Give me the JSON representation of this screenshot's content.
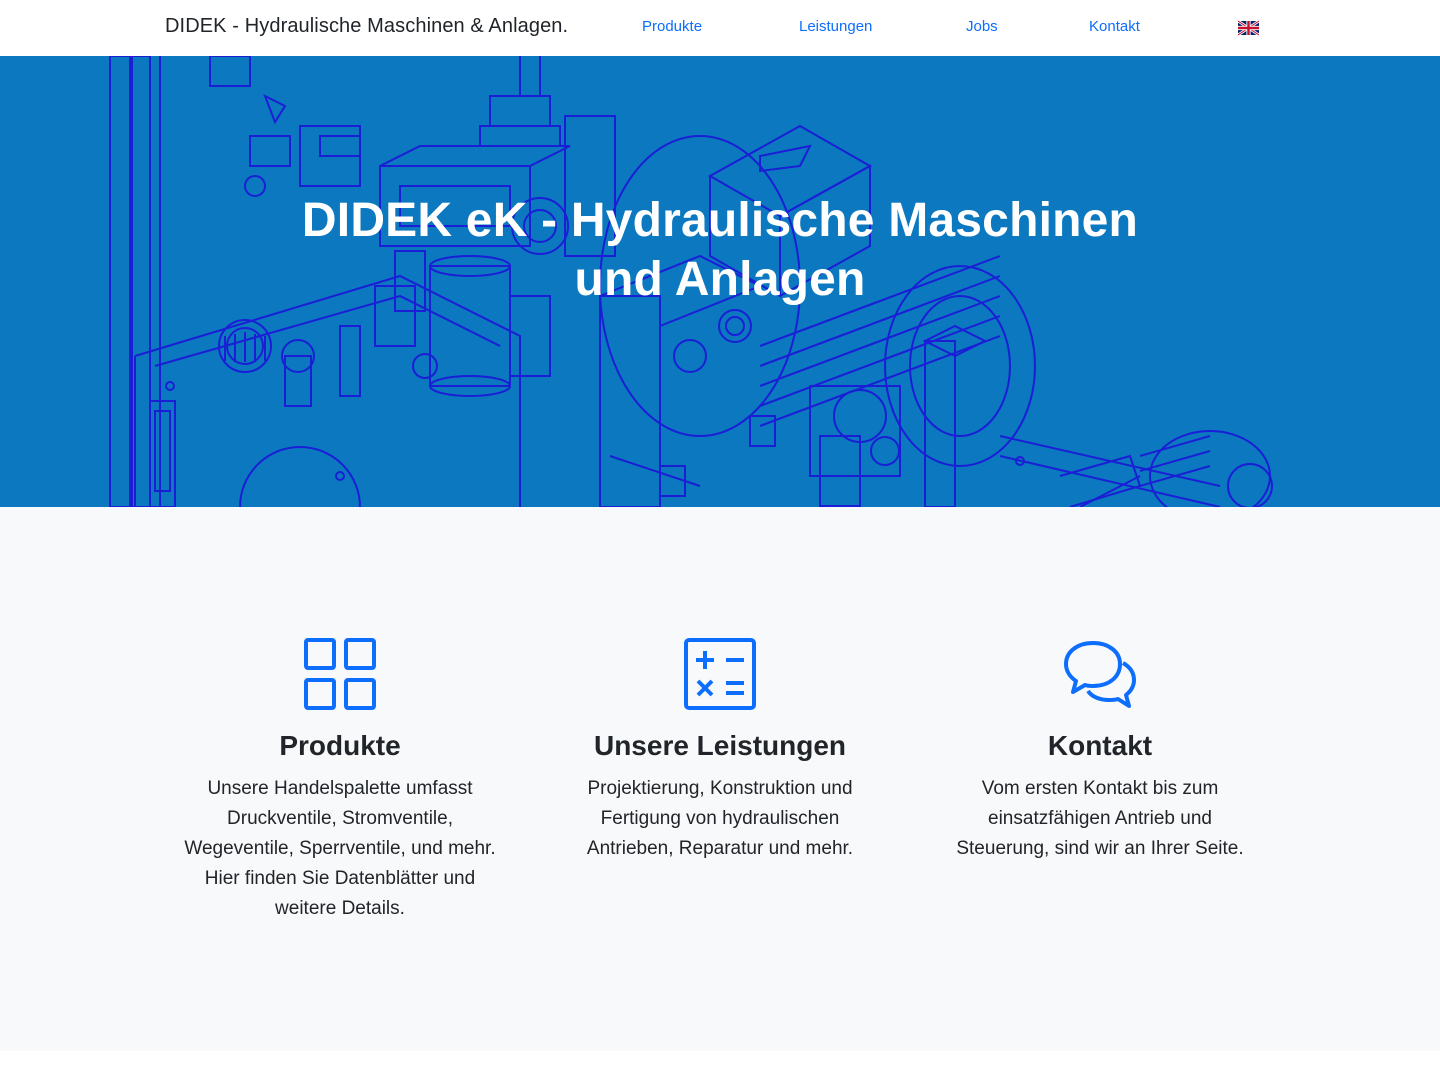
{
  "navbar": {
    "brand": "DIDEK - Hydraulische Maschinen & Anlagen.",
    "links": [
      {
        "label": "Produkte"
      },
      {
        "label": "Leistungen"
      },
      {
        "label": "Jobs"
      },
      {
        "label": "Kontakt"
      }
    ],
    "language_icon": "uk-flag-icon"
  },
  "hero": {
    "title": "DIDEK eK - Hydraulische Maschinen und Anlagen",
    "background_color": "#0b78bf",
    "line_art_color": "#1a1fd6"
  },
  "features": [
    {
      "icon": "grid-icon",
      "title": "Produkte",
      "text": "Unsere Handelspalette umfasst Druckventile, Stromventile, Wegeventile, Sperrventile, und mehr. Hier finden Sie Datenblätter und weitere Details."
    },
    {
      "icon": "calculator-icon",
      "title": "Unsere Leistungen",
      "text": "Projektierung, Konstruktion und Fertigung von hydraulischen Antrieben, Reparatur und mehr."
    },
    {
      "icon": "chat-bubbles-icon",
      "title": "Kontakt",
      "text": "Vom ersten Kontakt bis zum einsatzfähigen Antrieb und Steuerung, sind wir an Ihrer Seite."
    }
  ],
  "colors": {
    "accent": "#0d6efd",
    "section_bg": "#f8f9fa",
    "text": "#212529"
  }
}
